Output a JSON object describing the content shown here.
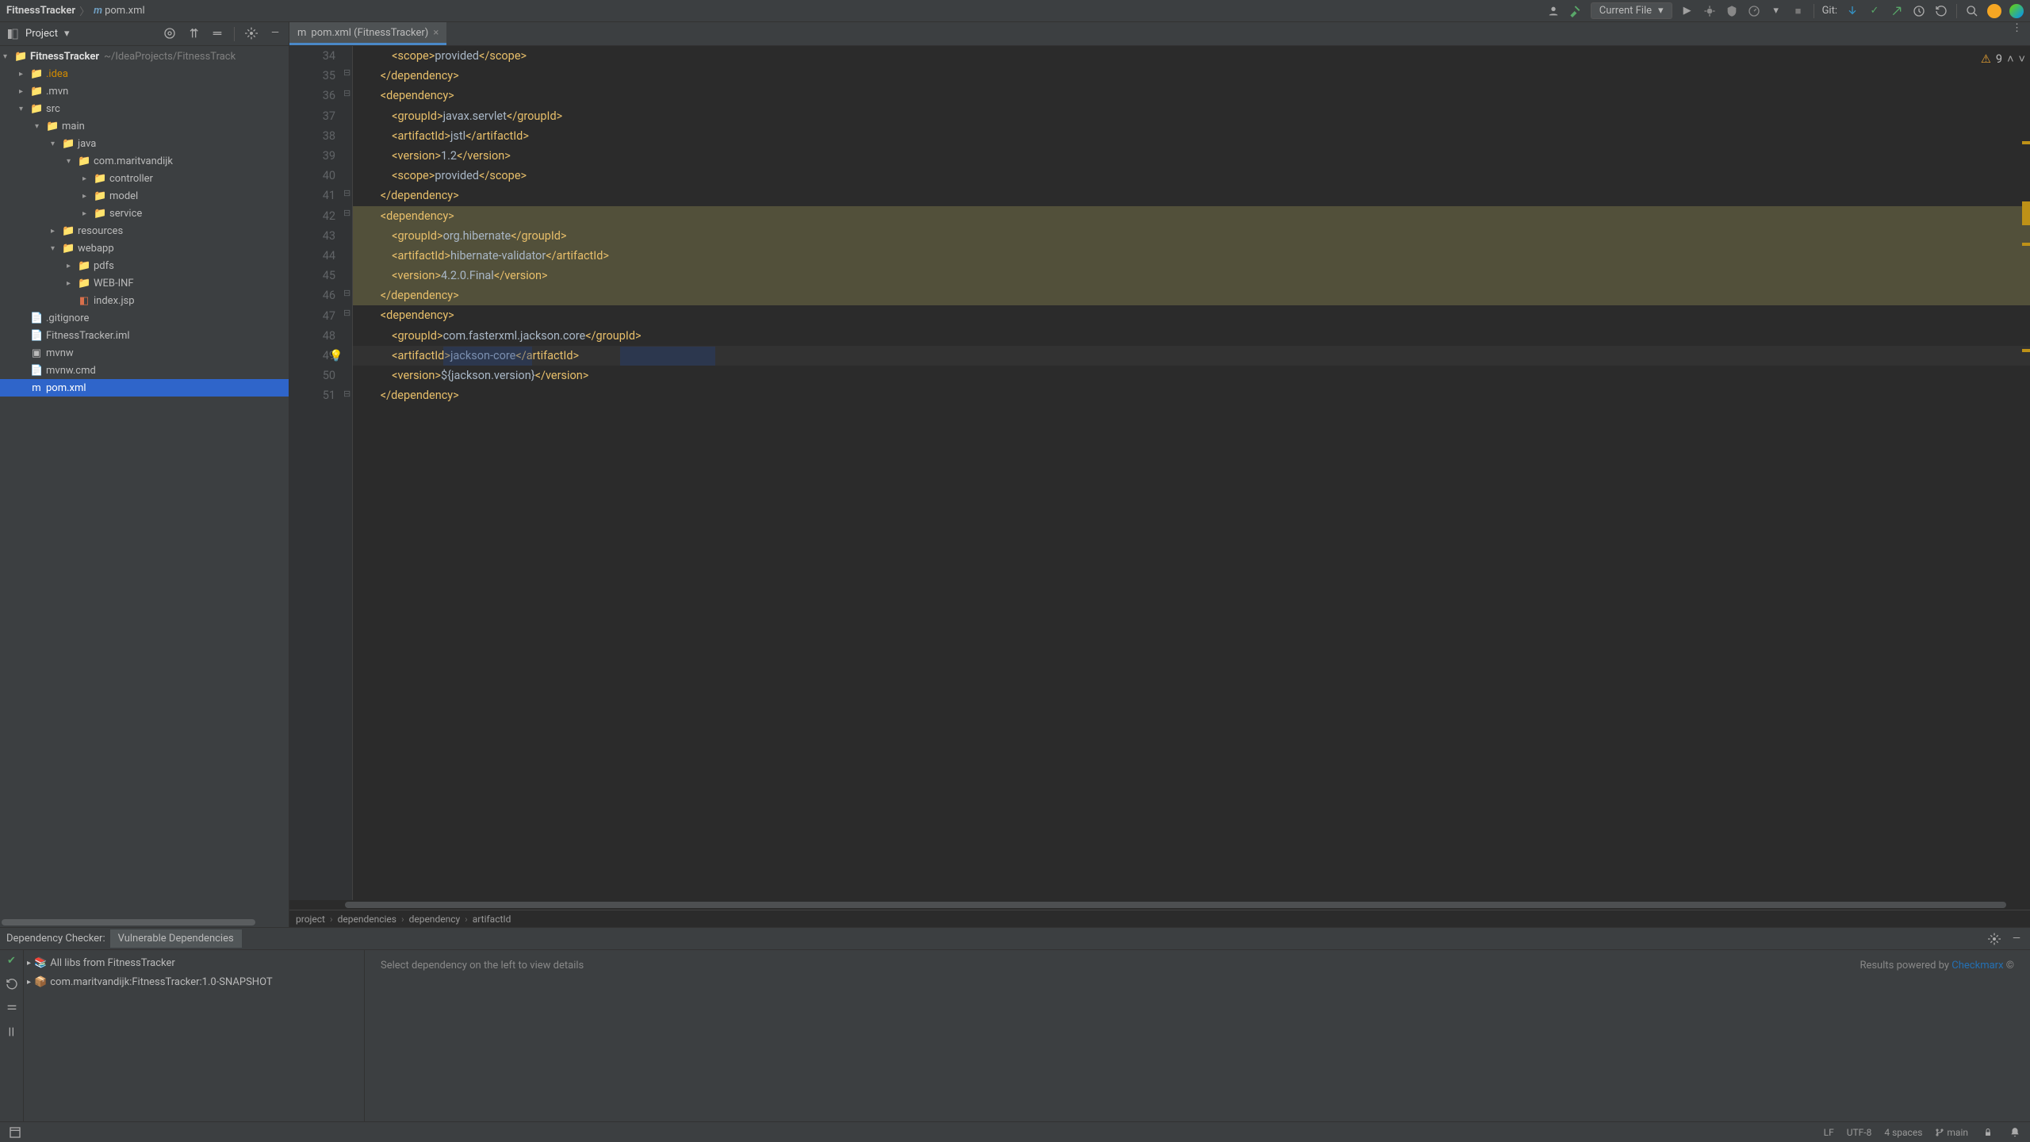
{
  "top": {
    "project": "FitnessTracker",
    "file": "pom.xml",
    "run_config": "Current File",
    "git_label": "Git:"
  },
  "project_tool": {
    "title": "Project"
  },
  "tab": {
    "label": "pom.xml (FitnessTracker)"
  },
  "tree": {
    "root": "FitnessTracker",
    "root_path": "~/IdeaProjects/FitnessTrack",
    "idea": ".idea",
    "mvn": ".mvn",
    "src": "src",
    "main": "main",
    "java": "java",
    "pkg": "com.maritvandijk",
    "controller": "controller",
    "model": "model",
    "service": "service",
    "resources": "resources",
    "webapp": "webapp",
    "pdfs": "pdfs",
    "webinf": "WEB-INF",
    "indexjsp": "index.jsp",
    "gitignore": ".gitignore",
    "iml": "FitnessTracker.iml",
    "mvnw": "mvnw",
    "mvnwcmd": "mvnw.cmd",
    "pom": "pom.xml"
  },
  "inspection": {
    "warn_count": "9"
  },
  "code": {
    "l34": "            <scope>provided</scope>",
    "l35": "        </dependency>",
    "l36": "        <dependency>",
    "l37": "            <groupId>javax.servlet</groupId>",
    "l38": "            <artifactId>jstl</artifactId>",
    "l39": "            <version>1.2</version>",
    "l40": "            <scope>provided</scope>",
    "l41": "        </dependency>",
    "l42": "        <dependency>",
    "l43": "            <groupId>org.hibernate</groupId>",
    "l44": "            <artifactId>hibernate-validator</artifactId>",
    "l45": "            <version>4.2.0.Final</version>",
    "l46": "        </dependency>",
    "l47": "        <dependency>",
    "l48": "            <groupId>com.fasterxml.jackson.core</groupId>",
    "l49": "            <artifactId>jackson-core</artifactId>",
    "l50": "            <version>${jackson.version}</version>",
    "l51": "        </dependency>"
  },
  "line_nums": [
    "34",
    "35",
    "36",
    "37",
    "38",
    "39",
    "40",
    "41",
    "42",
    "43",
    "44",
    "45",
    "46",
    "47",
    "48",
    "49",
    "50",
    "51"
  ],
  "breadcrumb": {
    "p1": "project",
    "p2": "dependencies",
    "p3": "dependency",
    "p4": "artifactId"
  },
  "dep_checker": {
    "title": "Dependency Checker:",
    "tab": "Vulnerable Dependencies",
    "item1": "All libs from FitnessTracker",
    "item2": "com.maritvandijk:FitnessTracker:1.0-SNAPSHOT",
    "detail_msg": "Select dependency on the left to view details",
    "powered_prefix": "Results powered by ",
    "powered_link": "Checkmarx",
    "powered_suffix": " ©"
  },
  "status": {
    "lf": "LF",
    "enc": "UTF-8",
    "indent": "4 spaces",
    "branch": "main"
  }
}
